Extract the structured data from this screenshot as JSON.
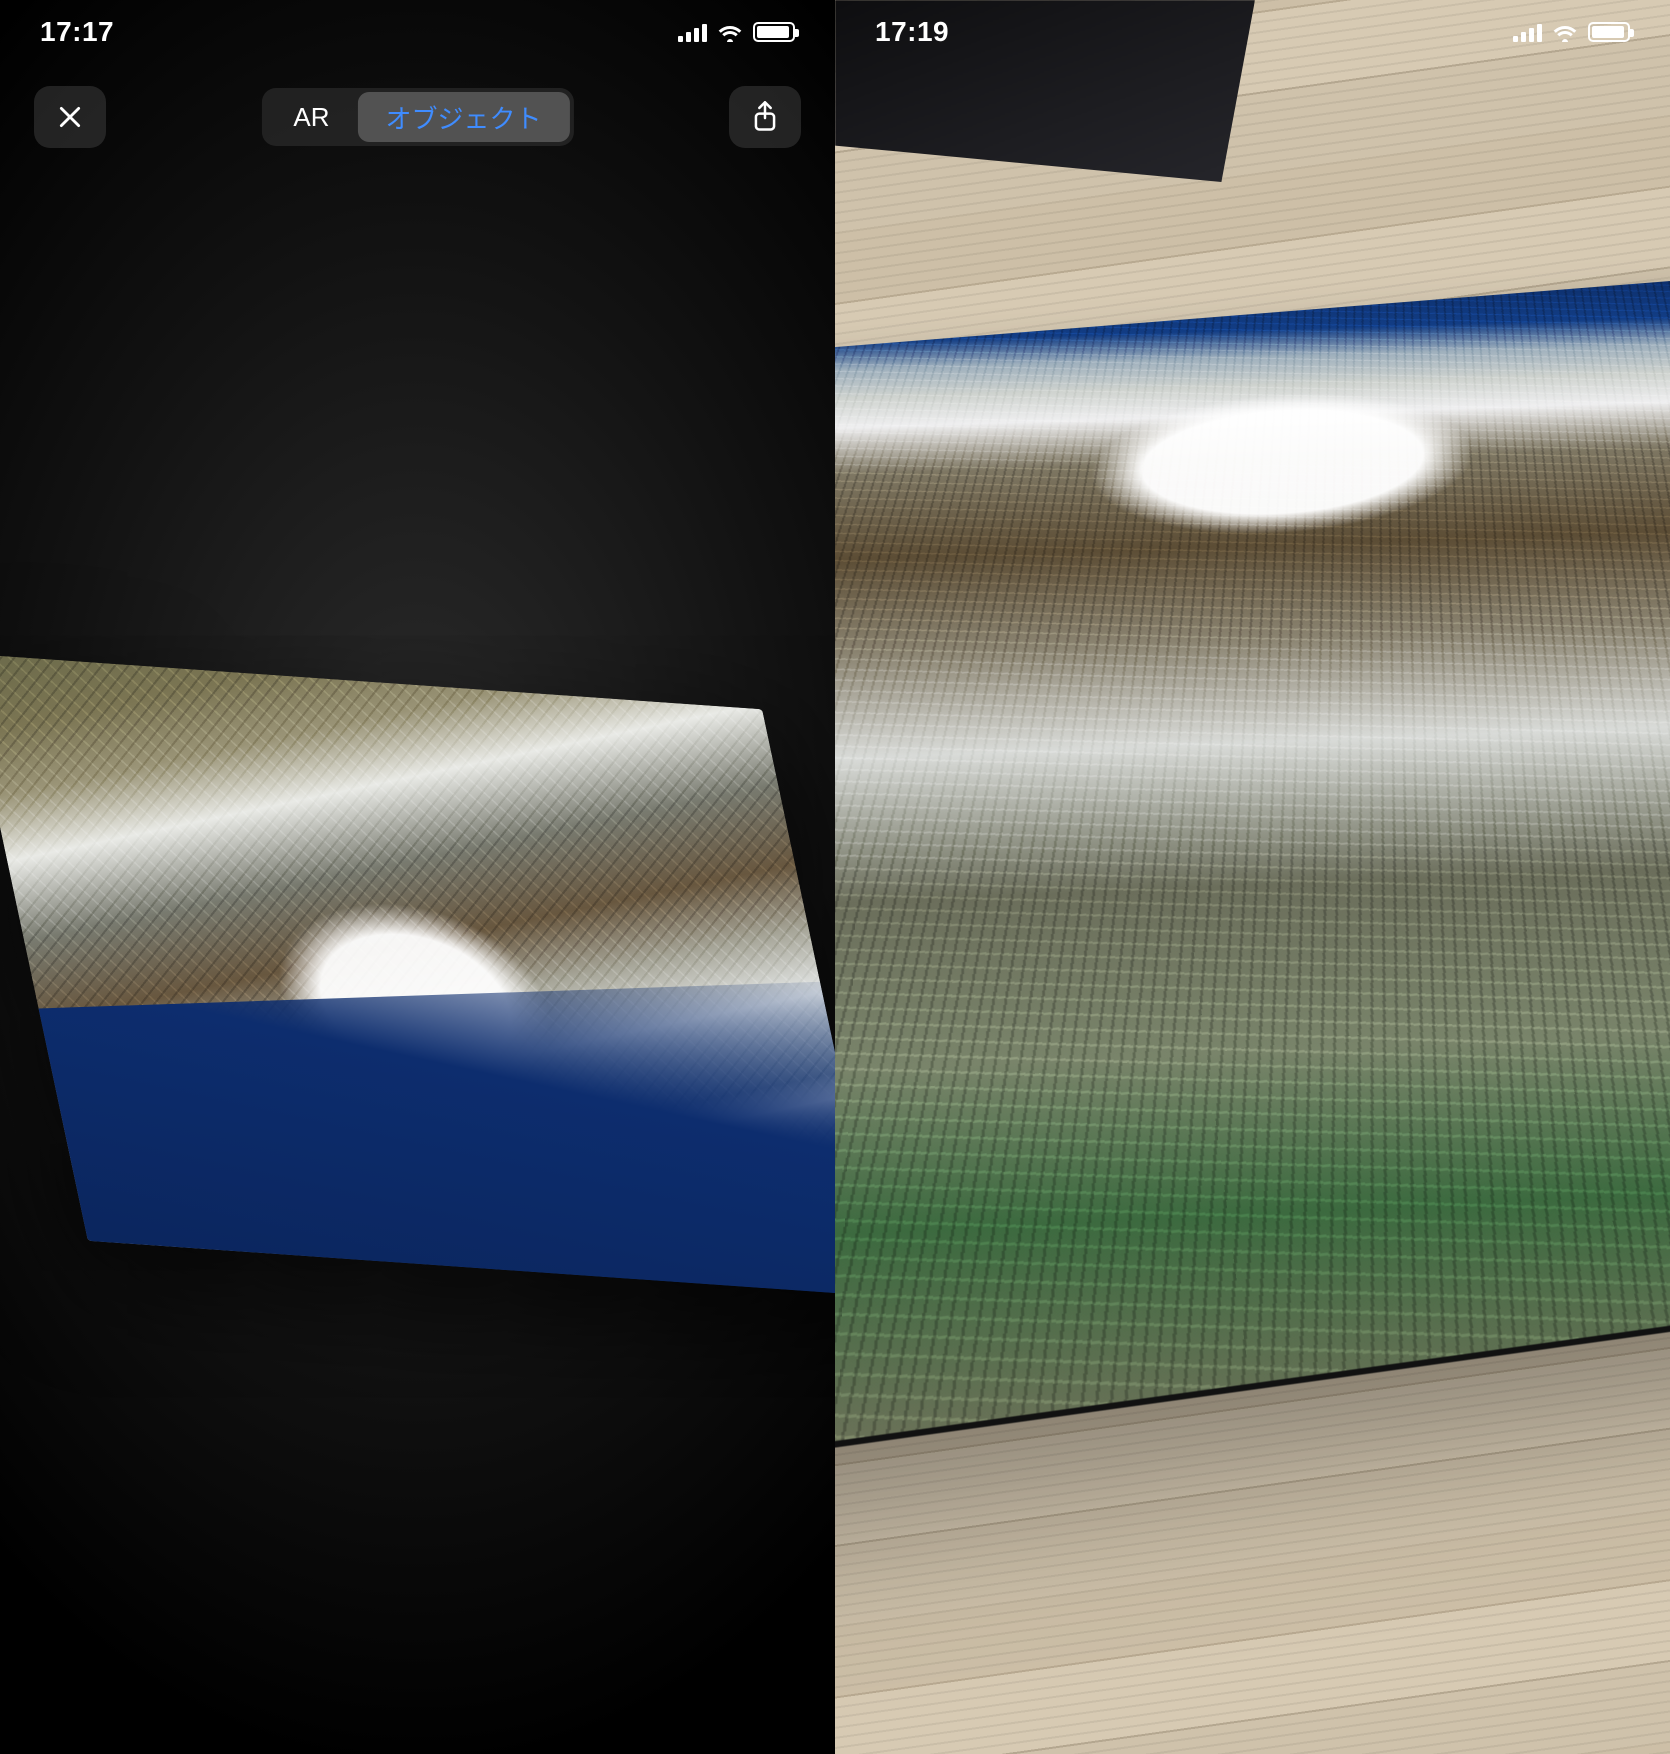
{
  "left": {
    "status": {
      "time": "17:17"
    },
    "toolbar": {
      "segments": {
        "ar": "AR",
        "object": "オブジェクト"
      },
      "active_segment": "object"
    }
  },
  "right": {
    "status": {
      "time": "17:19"
    }
  }
}
